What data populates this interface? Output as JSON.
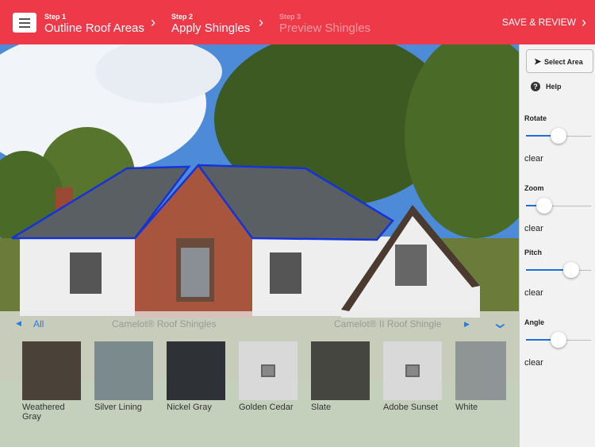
{
  "header": {
    "menu_icon": "hamburger-icon",
    "steps": [
      {
        "num": "Step 1",
        "title": "Outline Roof Areas"
      },
      {
        "num": "Step 2",
        "title": "Apply Shingles"
      },
      {
        "num": "Step 3",
        "title": "Preview Shingles"
      }
    ],
    "save": "SAVE & REVIEW",
    "color": "#ee3a48"
  },
  "panel": {
    "select_area": "Select Area",
    "help": "Help",
    "controls": [
      {
        "label": "Rotate",
        "value": 0.5,
        "clear": "clear"
      },
      {
        "label": "Zoom",
        "value": 0.28,
        "clear": "clear"
      },
      {
        "label": "Pitch",
        "value": 0.69,
        "clear": "clear"
      },
      {
        "label": "Angle",
        "value": 0.5,
        "clear": "clear"
      }
    ]
  },
  "tray": {
    "all": "All",
    "cat1": "Camelot® Roof Shingles",
    "cat2": "Camelot® II Roof Shingle",
    "swatches": [
      {
        "name": "Weathered Gray",
        "color": "#4a4238"
      },
      {
        "name": "Silver Lining",
        "color": "#7b8a8d"
      },
      {
        "name": "Nickel Gray",
        "color": "#2e3236"
      },
      {
        "name": "Golden Cedar",
        "color": ""
      },
      {
        "name": "Slate",
        "color": "#45463f"
      },
      {
        "name": "Adobe Sunset",
        "color": ""
      },
      {
        "name": "White",
        "color": "#8f9594"
      }
    ]
  },
  "outline_color": "#1533d6"
}
